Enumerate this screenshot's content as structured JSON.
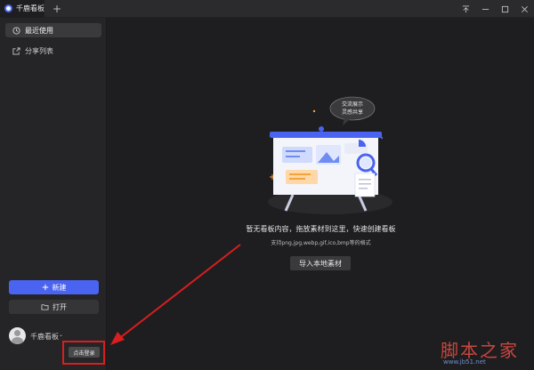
{
  "titlebar": {
    "tab_label": "千鹿看板",
    "new_tab": "+",
    "controls": [
      "pin",
      "minimize",
      "maximize",
      "close"
    ]
  },
  "sidebar": {
    "items": [
      {
        "label": "最近使用",
        "icon": "clock-icon",
        "active": true
      },
      {
        "label": "分享列表",
        "icon": "share-icon",
        "active": false
      }
    ],
    "new_button": "新建",
    "open_button": "打开",
    "user": {
      "name": "千鹿看板",
      "login_button": "点击登录"
    }
  },
  "main": {
    "bubble_line1": "交流展示",
    "bubble_line2": "灵感共享",
    "empty_title": "暂无看板内容，拖放素材到这里，快速创建看板",
    "empty_formats": "支持png,jpg,webp,gif,ico,bmp等的格式",
    "import_button": "导入本地素材"
  },
  "watermark": {
    "cn": "脚本之家",
    "url": "www.jb51.net"
  },
  "colors": {
    "accent": "#4a63f0",
    "highlight": "#d81e1e",
    "background": "#1e1e20",
    "sidebar": "#252527"
  }
}
